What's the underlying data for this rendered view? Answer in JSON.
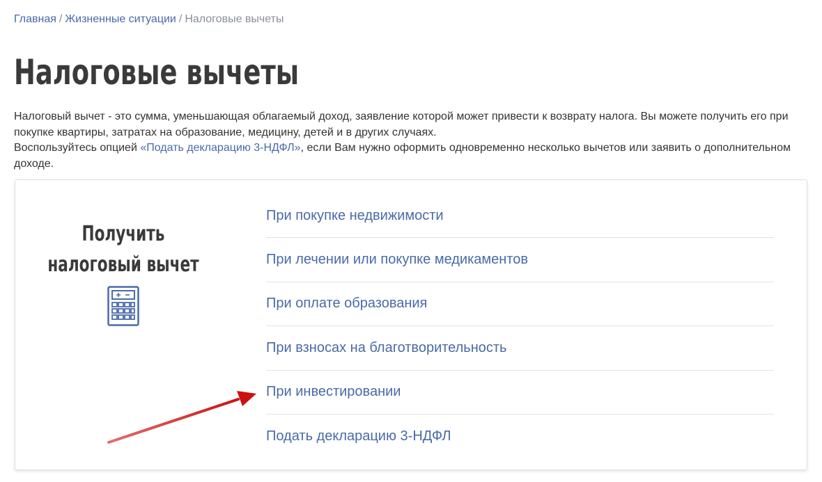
{
  "breadcrumb": {
    "home": "Главная",
    "separator": "/",
    "life_situations": "Жизненные ситуации",
    "current": "Налоговые вычеты"
  },
  "page": {
    "title": "Налоговые вычеты",
    "intro_part1": "Налоговый вычет - это сумма, уменьшающая облагаемый доход, заявление которой может привести к возврату налога. Вы можете получить его при покупке квартиры, затратах на образование, медицину, детей и в других случаях.",
    "intro_part2_before": "Воспользуйтесь опцией ",
    "intro_link": "«Подать декларацию 3-НДФЛ»",
    "intro_part2_after": ", если Вам нужно оформить одновременно несколько вычетов или заявить о дополнительном доходе."
  },
  "card": {
    "heading_line1": "Получить",
    "heading_line2": "налоговый вычет",
    "icon": "calculator-icon",
    "links": [
      {
        "label": "При покупке недвижимости"
      },
      {
        "label": "При лечении или покупке медикаментов"
      },
      {
        "label": "При оплате образования"
      },
      {
        "label": "При взносах на благотворительность"
      },
      {
        "label": "При инвестировании"
      },
      {
        "label": "Подать декларацию 3-НДФЛ"
      }
    ]
  },
  "colors": {
    "link": "#4a6aa8",
    "title": "#3a3a3a",
    "text": "#333333",
    "muted": "#8a8f98",
    "annotation_arrow": "#cc1111"
  }
}
